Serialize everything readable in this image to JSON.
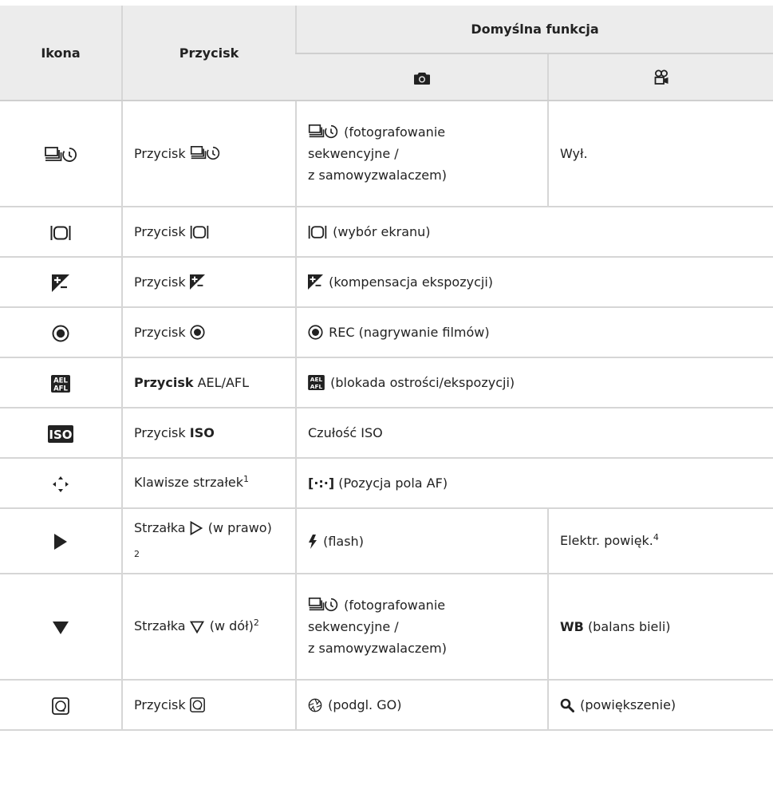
{
  "header": {
    "col_icon": "Ikona",
    "col_button": "Przycisk",
    "col_default": "Domyślna funkcja"
  },
  "rows": [
    {
      "icon": "drive-selftimer-icon",
      "button": "Przycisk",
      "photo_line1": "(fotografowanie",
      "photo_line2": "sekwencyjne /",
      "photo_line3": "z samowyzwalaczem)",
      "video": "Wył."
    },
    {
      "icon": "lv-display-icon",
      "button": "Przycisk",
      "photo": "(wybór ekranu)"
    },
    {
      "icon": "exposure-comp-icon",
      "button": "Przycisk",
      "photo": "(kompensacja ekspozycji)"
    },
    {
      "icon": "record-icon",
      "button": "Przycisk",
      "photo": "REC (nagrywanie filmów)"
    },
    {
      "icon": "ael-afl-icon",
      "button_bold": "Przycisk",
      "button_rest": "AEL/AFL",
      "photo": "(blokada ostrości/ekspozycji)"
    },
    {
      "icon": "iso-icon",
      "button": "Przycisk",
      "button_bold": "ISO",
      "photo": "Czułość ISO"
    },
    {
      "icon": "arrow-pad-icon",
      "button": "Klawisze strzałek",
      "button_sup": "1",
      "photo_bracket": "[·:·]",
      "photo": "(Pozycja pola AF)"
    },
    {
      "icon": "right-arrow-icon",
      "button_a": "Strzałka",
      "button_b": "(w prawo)",
      "button_sub": "2",
      "photo": "(flash)",
      "video": "Elektr. powięk.",
      "video_sup": "4"
    },
    {
      "icon": "down-arrow-icon",
      "button_a": "Strzałka",
      "button_b": "(w dół)",
      "button_sup": "2",
      "photo_line1": "(fotografowanie",
      "photo_line2": "sekwencyjne /",
      "photo_line3": "z samowyzwalaczem)",
      "video_bold": "WB",
      "video_rest": "(balans bieli)"
    },
    {
      "icon": "preview-button-icon",
      "button": "Przycisk",
      "photo": "(podgl. GO)",
      "video": "(powiększenie)"
    }
  ]
}
